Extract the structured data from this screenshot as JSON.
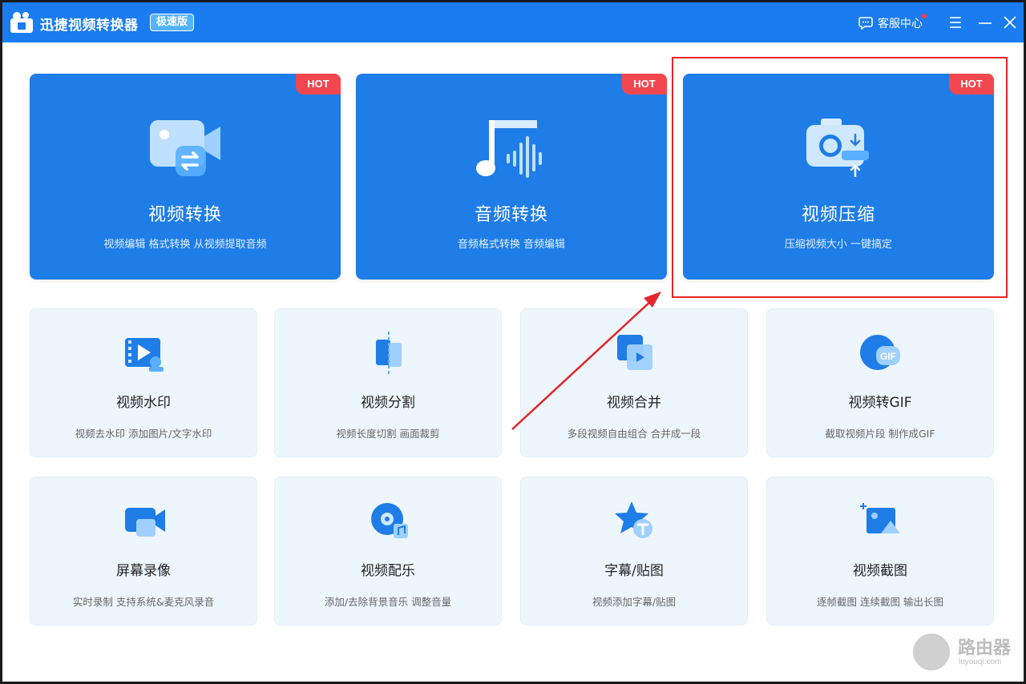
{
  "titlebar": {
    "app_title": "迅捷视频转换器",
    "edition": "极速版",
    "service_label": "客服中心",
    "icons": [
      "app-logo",
      "chat-icon",
      "menu-icon",
      "minimize-icon",
      "close-icon"
    ]
  },
  "colors": {
    "titlebar": "#1a7cf0",
    "big_card": "#1f7de7",
    "hot_badge": "#f2474f",
    "small_card": "#eef6fd",
    "highlight": "#e5242b"
  },
  "big_cards": [
    {
      "title": "视频转换",
      "subtitle": "视频编辑 格式转换 从视频提取音频",
      "badge": "HOT",
      "icon": "video-convert-icon"
    },
    {
      "title": "音频转换",
      "subtitle": "音频格式转换 音频编辑",
      "badge": "HOT",
      "icon": "audio-convert-icon"
    },
    {
      "title": "视频压缩",
      "subtitle": "压缩视频大小 一键搞定",
      "badge": "HOT",
      "icon": "video-compress-icon"
    }
  ],
  "small_cards": [
    {
      "title": "视频水印",
      "subtitle": "视频去水印 添加图片/文字水印",
      "icon": "watermark-icon"
    },
    {
      "title": "视频分割",
      "subtitle": "视频长度切割 画面裁剪",
      "icon": "split-icon"
    },
    {
      "title": "视频合并",
      "subtitle": "多段视频自由组合 合并成一段",
      "icon": "merge-icon"
    },
    {
      "title": "视频转GIF",
      "subtitle": "截取视频片段 制作成GIF",
      "icon": "gif-icon"
    },
    {
      "title": "屏幕录像",
      "subtitle": "实时录制 支持系统&麦克风录音",
      "icon": "screen-record-icon"
    },
    {
      "title": "视频配乐",
      "subtitle": "添加/去除背景音乐 调整音量",
      "icon": "music-icon"
    },
    {
      "title": "字幕/贴图",
      "subtitle": "视频添加字幕/贴图",
      "icon": "subtitle-icon"
    },
    {
      "title": "视频截图",
      "subtitle": "逐帧截图 连续截图 输出长图",
      "icon": "screenshot-icon"
    }
  ],
  "gif_label": "GIF",
  "watermark": {
    "text": "路由器",
    "url": "luyouqi.com"
  }
}
